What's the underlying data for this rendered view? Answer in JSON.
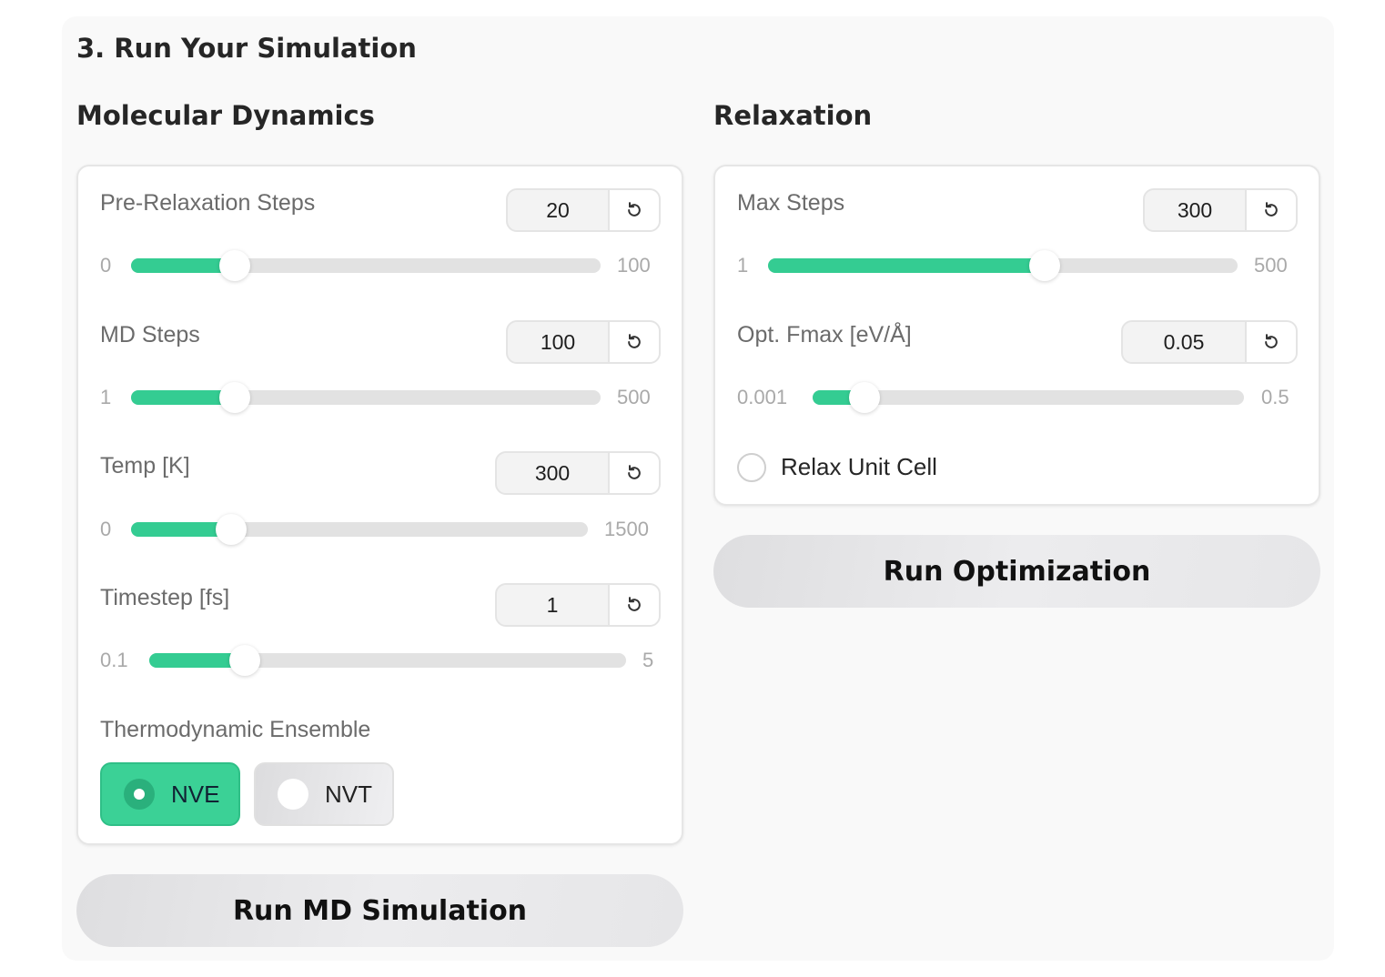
{
  "section_title": "3. Run Your Simulation",
  "md": {
    "title": "Molecular Dynamics",
    "fields": [
      {
        "label": "Pre-Relaxation Steps",
        "value": "20",
        "min": "0",
        "max": "100",
        "fraction": 0.2
      },
      {
        "label": "MD Steps",
        "value": "100",
        "min": "1",
        "max": "500",
        "fraction": 0.2
      },
      {
        "label": "Temp [K]",
        "value": "300",
        "min": "0",
        "max": "1500",
        "fraction": 0.2
      },
      {
        "label": "Timestep [fs]",
        "value": "1",
        "min": "0.1",
        "max": "5",
        "fraction": 0.2
      }
    ],
    "ensemble_label": "Thermodynamic Ensemble",
    "ensemble_options": [
      "NVE",
      "NVT"
    ],
    "ensemble_selected": "NVE",
    "run_label": "Run MD Simulation"
  },
  "relax": {
    "title": "Relaxation",
    "fields": [
      {
        "label": "Max Steps",
        "value": "300",
        "min": "1",
        "max": "500",
        "fraction": 0.6
      },
      {
        "label": "Opt. Fmax [eV/Å]",
        "value": "0.05",
        "min": "0.001",
        "max": "0.5",
        "fraction": 0.1
      }
    ],
    "relax_cell_label": "Relax Unit Cell",
    "relax_cell_checked": false,
    "run_label": "Run Optimization"
  },
  "colors": {
    "accent": "#34cc92",
    "track": "#e2e2e2"
  },
  "icons": {
    "reset": "reset-icon"
  }
}
